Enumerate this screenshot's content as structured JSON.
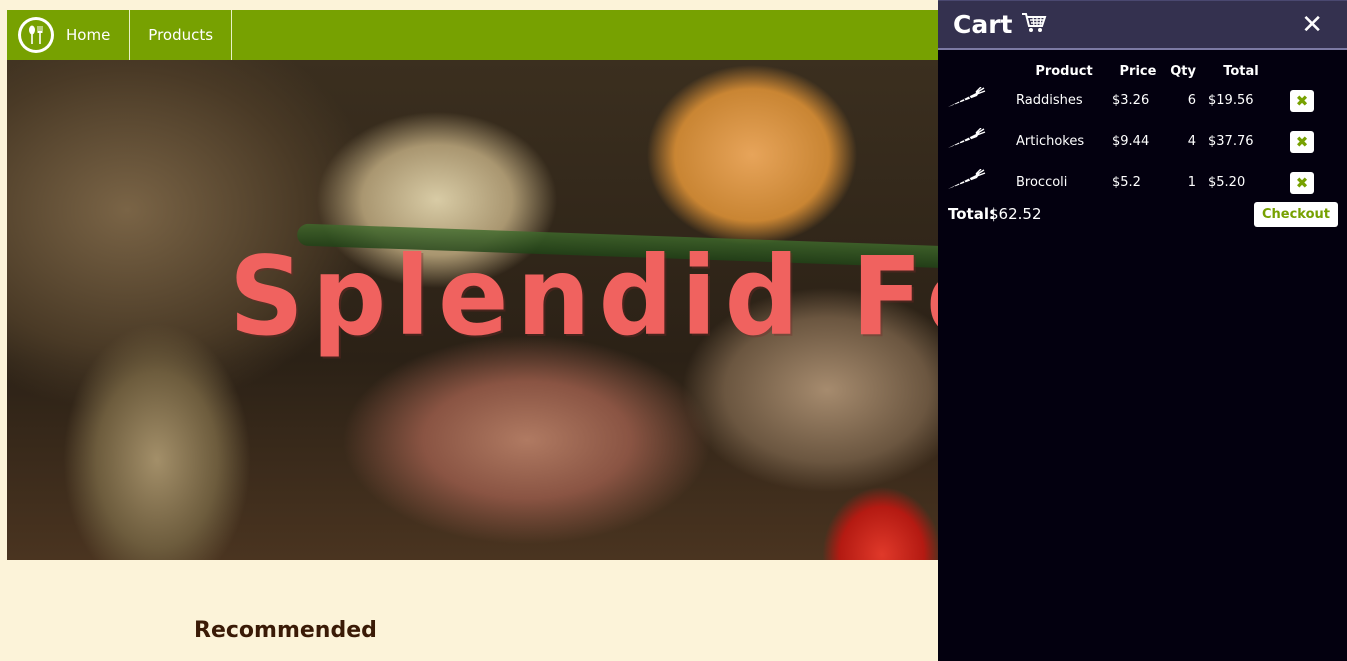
{
  "nav": {
    "logo_icon": "fork-spoon-icon",
    "items": [
      {
        "label": "Home"
      },
      {
        "label": "Products"
      }
    ]
  },
  "hero": {
    "title": "Splendid Fo"
  },
  "section": {
    "recommended_label": "Recommended"
  },
  "cart": {
    "title": "Cart",
    "cart_icon": "shopping-cart-icon",
    "close_icon": "close-icon",
    "columns": {
      "product": "Product",
      "price": "Price",
      "qty": "Qty",
      "total": "Total"
    },
    "items": [
      {
        "name": "Raddishes",
        "price": "$3.26",
        "qty": "6",
        "total": "$19.56",
        "icon": "carrot-icon"
      },
      {
        "name": "Artichokes",
        "price": "$9.44",
        "qty": "4",
        "total": "$37.76",
        "icon": "carrot-icon"
      },
      {
        "name": "Broccoli",
        "price": "$5.2",
        "qty": "1",
        "total": "$5.20",
        "icon": "carrot-icon"
      }
    ],
    "total_label": "Total:",
    "total_value": "$62.52",
    "checkout_label": "Checkout"
  },
  "colors": {
    "accent_green": "#77a101",
    "cart_bg": "#03000f",
    "cart_header_bg": "#34314f",
    "page_bg": "#fcf3d9",
    "hero_title": "#f0625f"
  }
}
